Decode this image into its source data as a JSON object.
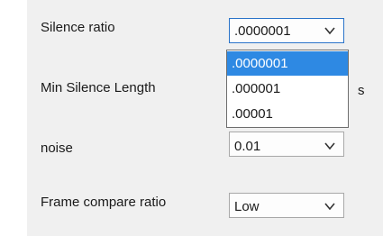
{
  "fields": {
    "silence_ratio": {
      "label": "Silence ratio",
      "value": ".0000001"
    },
    "min_silence_length": {
      "label": "Min Silence Length",
      "unit": "s"
    },
    "noise": {
      "label": "noise",
      "value": "0.01"
    },
    "frame_compare_ratio": {
      "label": "Frame compare ratio",
      "value": "Low"
    }
  },
  "dropdown": {
    "selected_index": 0,
    "options": [
      ".0000001",
      ".000001",
      ".00001"
    ]
  },
  "colors": {
    "highlight": "#2e89e3",
    "focus_border": "#2a73c9",
    "panel": "#f0f0f0"
  },
  "icons": {
    "dropdown_arrow": "chevron-down-icon"
  }
}
